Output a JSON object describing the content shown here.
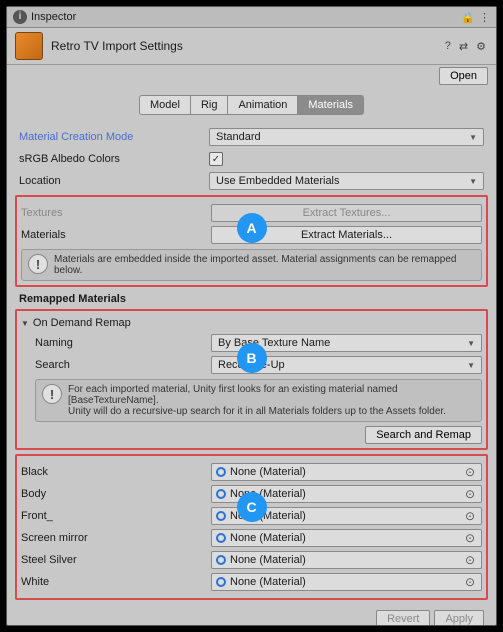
{
  "window": {
    "title": "Inspector"
  },
  "header": {
    "asset_title": "Retro TV Import Settings",
    "open_btn": "Open"
  },
  "tabs": {
    "model": "Model",
    "rig": "Rig",
    "animation": "Animation",
    "materials": "Materials"
  },
  "fields": {
    "material_creation_mode": {
      "label": "Material Creation Mode",
      "value": "Standard"
    },
    "srgb_albedo": {
      "label": "sRGB Albedo Colors",
      "checked": true
    },
    "location": {
      "label": "Location",
      "value": "Use Embedded Materials"
    },
    "textures": {
      "label": "Textures",
      "button": "Extract Textures..."
    },
    "materials": {
      "label": "Materials",
      "button": "Extract Materials..."
    }
  },
  "info_embedded": "Materials are embedded inside the imported asset. Material assignments can be remapped below.",
  "remapped": {
    "section_label": "Remapped Materials",
    "foldout": "On Demand Remap",
    "naming": {
      "label": "Naming",
      "value": "By Base Texture Name"
    },
    "search": {
      "label": "Search",
      "value": "Recursive-Up"
    },
    "info": "For each imported material, Unity first looks for an existing material named [BaseTextureName].\nUnity will do a recursive-up search for it in all Materials folders up to the Assets folder.",
    "search_remap_btn": "Search and Remap"
  },
  "slots": [
    {
      "label": "Black",
      "value": "None (Material)"
    },
    {
      "label": "Body",
      "value": "None (Material)"
    },
    {
      "label": "Front_",
      "value": "None (Material)"
    },
    {
      "label": "Screen mirror",
      "value": "None (Material)"
    },
    {
      "label": "Steel Silver",
      "value": "None (Material)"
    },
    {
      "label": "White",
      "value": "None (Material)"
    }
  ],
  "footer": {
    "revert": "Revert",
    "apply": "Apply"
  },
  "callouts": {
    "a": "A",
    "b": "B",
    "c": "C"
  }
}
